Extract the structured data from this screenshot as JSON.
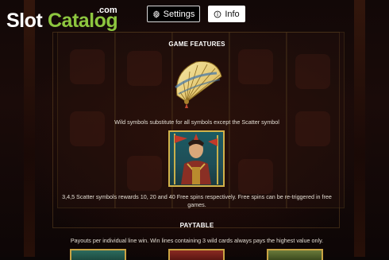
{
  "brand": {
    "name_part1": "Slot",
    "name_part2": "Catalog",
    "domain_suffix": ".com",
    "colors": {
      "white_part": "#ffffff",
      "green_part": "#8dc63f"
    }
  },
  "toolbar": {
    "settings_label": "Settings",
    "settings_icon": "gear-icon",
    "info_label": "Info",
    "info_icon": "info-circle-icon"
  },
  "sections": {
    "game_features": {
      "heading": "GAME FEATURES",
      "wild_text": "Wild symbols substitute for all symbols except the Scatter symbol",
      "scatter_text": "3,4,5 Scatter symbols rewards 10, 20 and 40 Free spins respectively. Free spins can be re-triggered in free games."
    },
    "paytable": {
      "heading": "PAYTABLE",
      "text": "Payouts per individual line win. Win lines containing 3 wild cards always pays the highest value only."
    }
  },
  "colors": {
    "background": "#0b0606",
    "gold_border": "#d2b24a"
  }
}
